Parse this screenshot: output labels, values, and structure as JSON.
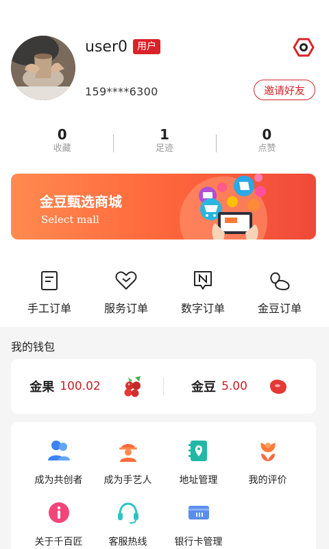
{
  "profile": {
    "username": "user0",
    "role_badge": "用户",
    "phone": "159****6300",
    "invite_label": "邀请好友"
  },
  "stats": [
    {
      "value": "0",
      "label": "收藏"
    },
    {
      "value": "1",
      "label": "足迹"
    },
    {
      "value": "0",
      "label": "点赞"
    }
  ],
  "banner": {
    "title": "金豆甄选商城",
    "subtitle": "Select mall"
  },
  "orders": [
    {
      "label": "手工订单",
      "icon": "document-icon"
    },
    {
      "label": "服务订单",
      "icon": "heart-icon"
    },
    {
      "label": "数字订单",
      "icon": "n-chat-icon"
    },
    {
      "label": "金豆订单",
      "icon": "bean-icon"
    }
  ],
  "wallet": {
    "title": "我的钱包",
    "jinguo_label": "金果",
    "jinguo_value": "100.02",
    "jindou_label": "金豆",
    "jindou_value": "5.00"
  },
  "tools": [
    {
      "label": "成为共创者",
      "icon": "users-icon"
    },
    {
      "label": "成为手艺人",
      "icon": "craftsman-icon"
    },
    {
      "label": "地址管理",
      "icon": "address-book-icon"
    },
    {
      "label": "我的评价",
      "icon": "flower-icon"
    },
    {
      "label": "关于千百匠",
      "icon": "info-icon"
    },
    {
      "label": "客服热线",
      "icon": "headset-icon"
    },
    {
      "label": "银行卡管理",
      "icon": "bank-card-icon"
    }
  ],
  "colors": {
    "accent": "#d9222a",
    "banner_start": "#ff8a50",
    "banner_end": "#f04a3a",
    "background": "#f5f5f5"
  }
}
